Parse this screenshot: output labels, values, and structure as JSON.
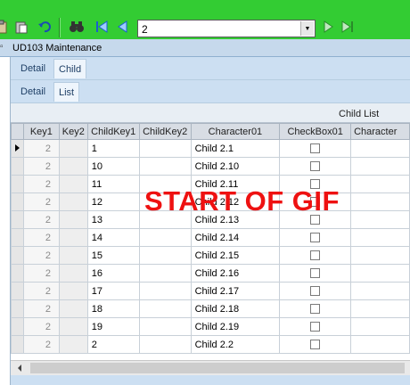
{
  "toolbar": {
    "icons": [
      "clipboard-icon",
      "paste-icon",
      "undo-icon",
      "binoculars-icon",
      "first-record-icon",
      "previous-record-icon",
      "next-record-icon",
      "last-record-icon"
    ],
    "record_value": "2"
  },
  "window": {
    "title": "UD103 Maintenance"
  },
  "tabs_top": [
    {
      "label": "Detail"
    },
    {
      "label": "Child",
      "active": true
    }
  ],
  "tabs_sub": [
    {
      "label": "Detail"
    },
    {
      "label": "List",
      "active": true
    }
  ],
  "grid": {
    "band_label": "Child List",
    "columns": [
      "Key1",
      "Key2",
      "ChildKey1",
      "ChildKey2",
      "Character01",
      "CheckBox01",
      "Character"
    ],
    "rows": [
      {
        "key1": "2",
        "childkey1": "1",
        "character01": "Child 2.1"
      },
      {
        "key1": "2",
        "childkey1": "10",
        "character01": "Child 2.10"
      },
      {
        "key1": "2",
        "childkey1": "11",
        "character01": "Child 2.11"
      },
      {
        "key1": "2",
        "childkey1": "12",
        "character01": "Child 2.12"
      },
      {
        "key1": "2",
        "childkey1": "13",
        "character01": "Child 2.13"
      },
      {
        "key1": "2",
        "childkey1": "14",
        "character01": "Child 2.14"
      },
      {
        "key1": "2",
        "childkey1": "15",
        "character01": "Child 2.15"
      },
      {
        "key1": "2",
        "childkey1": "16",
        "character01": "Child 2.16"
      },
      {
        "key1": "2",
        "childkey1": "17",
        "character01": "Child 2.17"
      },
      {
        "key1": "2",
        "childkey1": "18",
        "character01": "Child 2.18"
      },
      {
        "key1": "2",
        "childkey1": "19",
        "character01": "Child 2.19"
      },
      {
        "key1": "2",
        "childkey1": "2",
        "character01": "Child 2.2"
      }
    ]
  },
  "overlay_text": "START OF GIF",
  "colors": {
    "background": "#33cc33",
    "overlay": "#ee1111",
    "tab_bar": "#ccdff2"
  }
}
